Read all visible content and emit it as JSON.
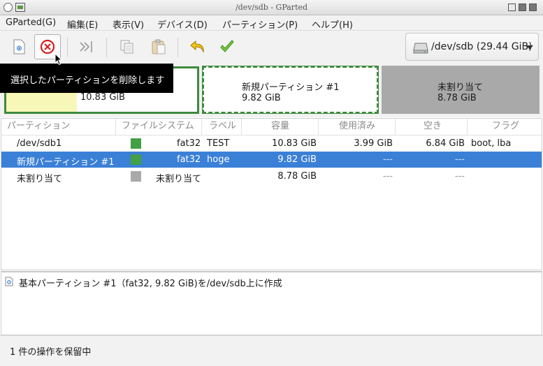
{
  "window": {
    "title": "/dev/sdb - GParted"
  },
  "menubar": {
    "items": [
      "GParted(G)",
      "編集(E)",
      "表示(V)",
      "デバイス(D)",
      "パーティション(P)",
      "ヘルプ(H)"
    ]
  },
  "toolbar": {
    "device_selector": "/dev/sdb (29.44 GiB)"
  },
  "tooltip": "選択したパーティションを削除します",
  "partitions_graphic": [
    {
      "name": "",
      "size": "10.83 GiB",
      "used_fraction": 0.37
    },
    {
      "name": "新規パーティション #1",
      "size": "9.82 GiB"
    },
    {
      "name": "未割り当て",
      "size": "8.78 GiB"
    }
  ],
  "table": {
    "headers": [
      "パーティション",
      "ファイルシステム",
      "ラベル",
      "容量",
      "使用済み",
      "空き",
      "フラグ"
    ],
    "rows": [
      {
        "partition": "/dev/sdb1",
        "filesystem": "fat32",
        "fs_color": "#43a047",
        "label": "TEST",
        "size": "10.83 GiB",
        "used": "3.99 GiB",
        "free": "6.84 GiB",
        "flags": "boot, lba",
        "selected": false
      },
      {
        "partition": "新規パーティション #1",
        "filesystem": "fat32",
        "fs_color": "#43a047",
        "label": "hoge",
        "size": "9.82 GiB",
        "used": "---",
        "free": "---",
        "flags": "",
        "selected": true
      },
      {
        "partition": "未割り当て",
        "filesystem": "未割り当て",
        "fs_color": "#a9a9a9",
        "label": "",
        "size": "8.78 GiB",
        "used": "---",
        "free": "---",
        "flags": "",
        "selected": false
      }
    ]
  },
  "operations": [
    "基本パーティション #1（fat32, 9.82 GiB)を/dev/sdb上に作成"
  ],
  "status": "1 件の操作を保留中",
  "colors": {
    "accent": "#3b80d7",
    "fat32": "#43a047",
    "unallocated": "#a9a9a9",
    "used": "#f7f7b8"
  }
}
